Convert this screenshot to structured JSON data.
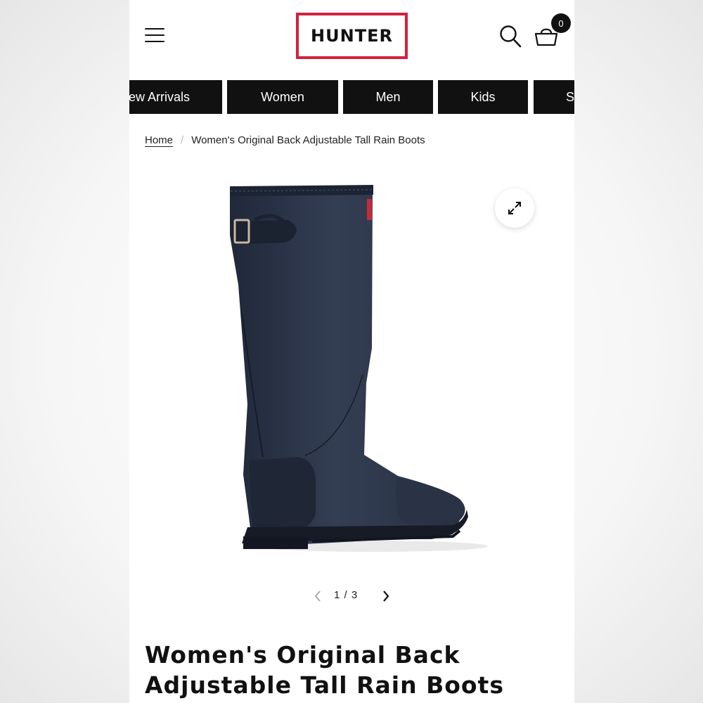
{
  "header": {
    "logo_text": "HUNTER",
    "cart_count": "0",
    "icons": [
      "hamburger-menu-icon",
      "search-icon",
      "basket-icon"
    ],
    "brand_color": "#d4213d"
  },
  "nav": {
    "tabs": [
      {
        "label": "New Arrivals"
      },
      {
        "label": "Women"
      },
      {
        "label": "Men"
      },
      {
        "label": "Kids"
      },
      {
        "label": "Sale"
      }
    ]
  },
  "breadcrumb": {
    "home": "Home",
    "separator": "/",
    "current": "Women's Original Back Adjustable Tall Rain Boots"
  },
  "gallery": {
    "current": "1",
    "separator": "/",
    "total": "3",
    "image": "navy-tall-rain-boot"
  },
  "product": {
    "title": "Women's Original Back Adjustable Tall Rain Boots"
  }
}
